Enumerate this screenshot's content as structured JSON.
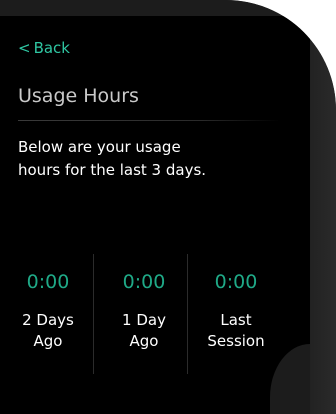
{
  "nav": {
    "back_chevron": "<",
    "back_label": "Back"
  },
  "page": {
    "title": "Usage Hours",
    "description_line1": "Below are your usage",
    "description_line2": "hours for the last 3 days."
  },
  "stats": [
    {
      "value": "0:00",
      "label_line1": "2 Days",
      "label_line2": "Ago"
    },
    {
      "value": "0:00",
      "label_line1": "1 Day",
      "label_line2": "Ago"
    },
    {
      "value": "0:00",
      "label_line1": "Last",
      "label_line2": "Session"
    }
  ],
  "colors": {
    "accent": "#2fc7a3",
    "value_text": "#1fa987",
    "title_text": "#c9c9c9",
    "body_text": "#ffffff",
    "screen_bg": "#000000",
    "bezel": "#1c1c1c"
  },
  "icons": {
    "back": "chevron-left-icon"
  }
}
